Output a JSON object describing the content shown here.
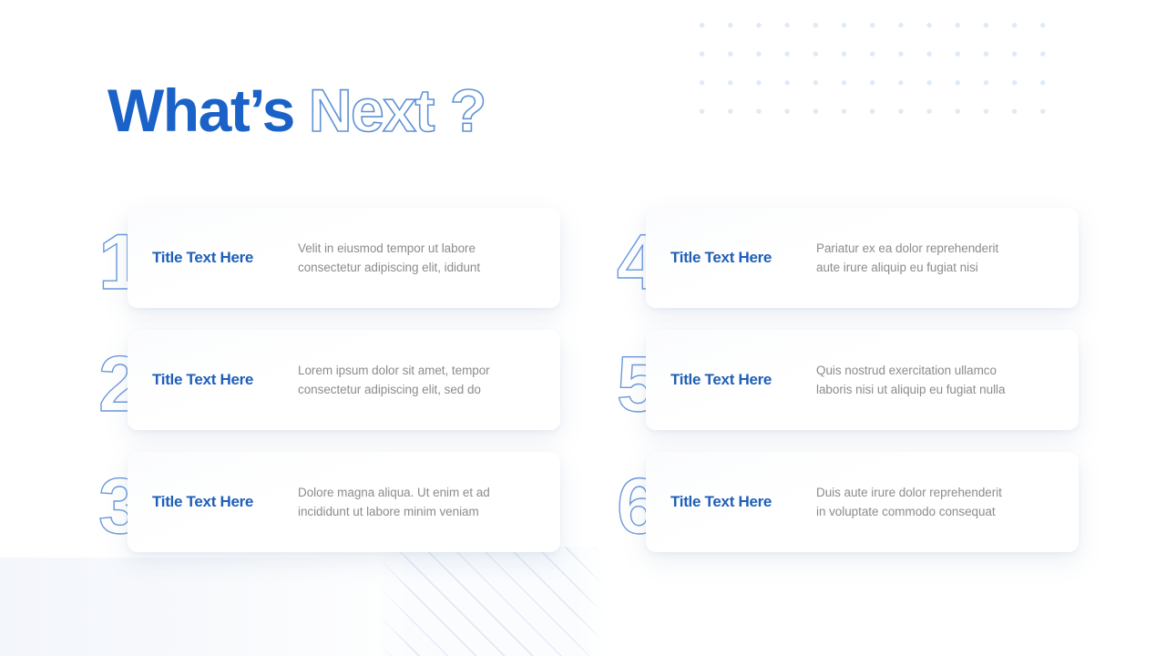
{
  "heading": {
    "solid_text": "What’s",
    "outline_text": "Next",
    "question_mark": "?"
  },
  "colors": {
    "brand_blue": "#1a62c7",
    "title_blue": "#1f5fb8",
    "outline_blue": "#5f92d6",
    "number_outline": "#6b99dc",
    "body_gray": "#8c8c8c",
    "dot_pattern": "#dfeaf8",
    "background": "#ffffff"
  },
  "decor": {
    "dot_grid_name": "dot-grid-pattern",
    "dot_grid_columns": 14,
    "dot_grid_rows": 5,
    "stripes_name": "diagonal-stripes-pattern"
  },
  "items": [
    {
      "number": "1",
      "title": "Title Text Here",
      "desc_line1": "Velit in eiusmod tempor ut labore",
      "desc_line2": "consectetur adipiscing elit, ididunt"
    },
    {
      "number": "2",
      "title": "Title Text Here",
      "desc_line1": "Lorem ipsum dolor sit amet, tempor",
      "desc_line2": "consectetur adipiscing elit, sed do"
    },
    {
      "number": "3",
      "title": "Title Text Here",
      "desc_line1": "Dolore magna aliqua. Ut enim et ad",
      "desc_line2": "incididunt ut labore minim veniam"
    },
    {
      "number": "4",
      "title": "Title Text Here",
      "desc_line1": "Pariatur ex ea dolor reprehenderit",
      "desc_line2": "aute irure aliquip eu fugiat nisi"
    },
    {
      "number": "5",
      "title": "Title Text Here",
      "desc_line1": "Quis nostrud exercitation ullamco",
      "desc_line2": "laboris nisi ut aliquip eu fugiat nulla"
    },
    {
      "number": "6",
      "title": "Title Text Here",
      "desc_line1": "Duis aute irure dolor reprehenderit",
      "desc_line2": "in voluptate commodo consequat"
    }
  ]
}
